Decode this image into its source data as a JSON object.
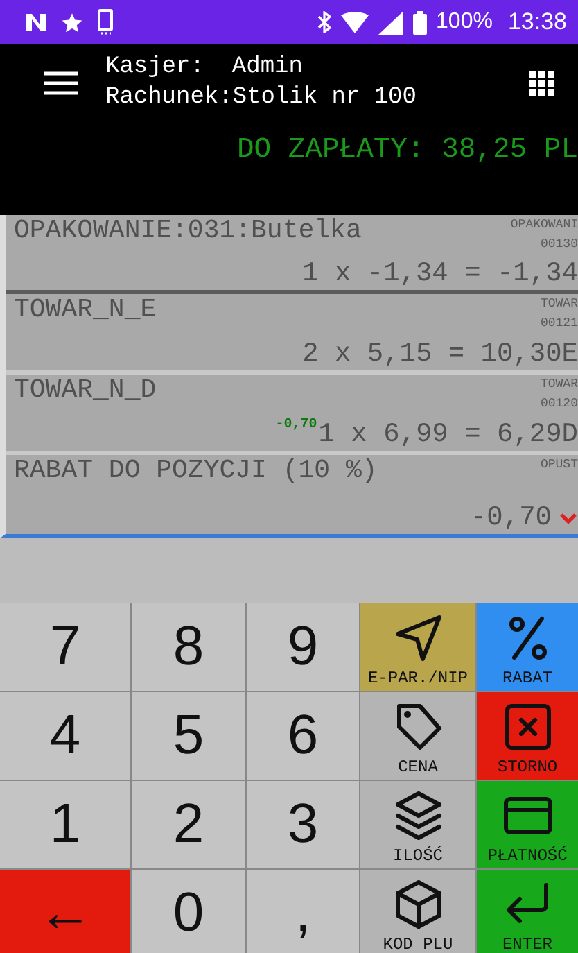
{
  "status_bar": {
    "battery": "100%",
    "time": "13:38"
  },
  "header": {
    "cashier_label": "Kasjer:",
    "cashier": "Admin",
    "bill_label": "Rachunek:",
    "bill": "Stolik nr 100",
    "amount_due": "DO ZAPŁATY: 38,25 PL"
  },
  "items": [
    {
      "kind": "product",
      "name": "OPAKOWANIE:031:Butelka",
      "code_type": "OPAKOWANI",
      "code": "00130",
      "line": "1 x -1,34 = -1,34"
    },
    {
      "kind": "product",
      "name": "TOWAR_N_E",
      "code_type": "TOWAR",
      "code": "00121",
      "line": "2 x 5,15 = 10,30E"
    },
    {
      "kind": "product",
      "name": "TOWAR_N_D",
      "code_type": "TOWAR",
      "code": "00120",
      "discount": "-0,70",
      "line": "1 x 6,99 = 6,29D"
    },
    {
      "kind": "discount",
      "name": "RABAT DO POZYCJI (10 %)",
      "code_type": "OPUST",
      "line": "-0,70"
    }
  ],
  "keypad": [
    {
      "kind": "digit",
      "label": "7",
      "color": "#c4c4c4"
    },
    {
      "kind": "digit",
      "label": "8",
      "color": "#c4c4c4"
    },
    {
      "kind": "digit",
      "label": "9",
      "color": "#c4c4c4"
    },
    {
      "kind": "send",
      "label": "E-PAR./NIP",
      "color": "#b8a54c"
    },
    {
      "kind": "percent",
      "label": "RABAT",
      "color": "#2f8ef0"
    },
    {
      "kind": "digit",
      "label": "4",
      "color": "#c4c4c4"
    },
    {
      "kind": "digit",
      "label": "5",
      "color": "#c4c4c4"
    },
    {
      "kind": "digit",
      "label": "6",
      "color": "#c4c4c4"
    },
    {
      "kind": "tag",
      "label": "CENA",
      "color": "#b4b4b4"
    },
    {
      "kind": "void",
      "label": "STORNO",
      "color": "#e21b0e"
    },
    {
      "kind": "digit",
      "label": "1",
      "color": "#c4c4c4"
    },
    {
      "kind": "digit",
      "label": "2",
      "color": "#c4c4c4"
    },
    {
      "kind": "digit",
      "label": "3",
      "color": "#c4c4c4"
    },
    {
      "kind": "layers",
      "label": "ILOŚĆ",
      "color": "#b4b4b4"
    },
    {
      "kind": "card",
      "label": "PŁATNOŚĆ",
      "color": "#17a81b"
    },
    {
      "kind": "digit",
      "label": "←",
      "color": "#e21b0e"
    },
    {
      "kind": "digit",
      "label": "0",
      "color": "#c4c4c4"
    },
    {
      "kind": "digit",
      "label": ",",
      "color": "#c4c4c4"
    },
    {
      "kind": "cube",
      "label": "KOD PLU",
      "color": "#b4b4b4"
    },
    {
      "kind": "enter",
      "label": "ENTER",
      "color": "#17a81b"
    }
  ]
}
